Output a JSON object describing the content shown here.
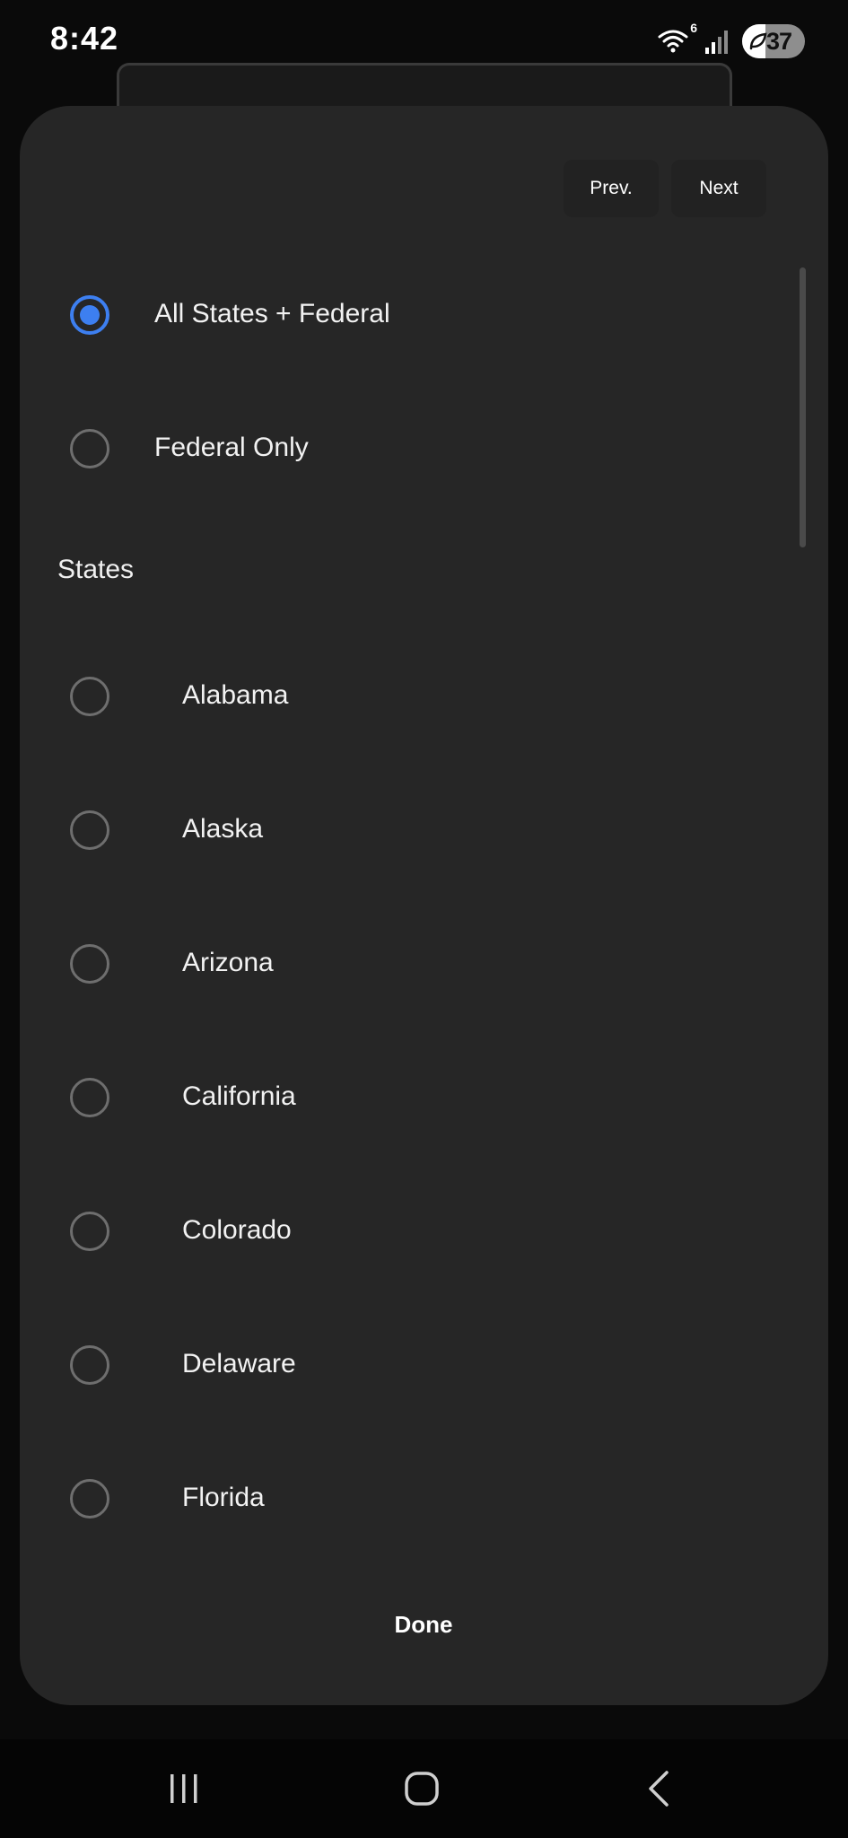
{
  "status_bar": {
    "time": "8:42",
    "wifi_badge": "6",
    "battery_level": "37",
    "battery_fraction": 0.37,
    "icons": [
      "wifi-icon",
      "signal-icon",
      "battery-icon",
      "leaf-icon"
    ]
  },
  "sheet": {
    "prev_label": "Prev.",
    "next_label": "Next",
    "top_options": [
      {
        "label": "All States + Federal",
        "selected": true
      },
      {
        "label": "Federal Only",
        "selected": false
      }
    ],
    "states_header": "States",
    "states": [
      {
        "label": "Alabama",
        "selected": false
      },
      {
        "label": "Alaska",
        "selected": false
      },
      {
        "label": "Arizona",
        "selected": false
      },
      {
        "label": "California",
        "selected": false
      },
      {
        "label": "Colorado",
        "selected": false
      },
      {
        "label": "Delaware",
        "selected": false
      },
      {
        "label": "Florida",
        "selected": false
      }
    ],
    "done_label": "Done"
  },
  "colors": {
    "accent": "#3d7ff0",
    "sheet_bg": "#262626",
    "screen_bg": "#0a0a0a"
  },
  "nav_bar": {
    "icons": [
      "recents-icon",
      "home-icon",
      "back-icon"
    ]
  }
}
